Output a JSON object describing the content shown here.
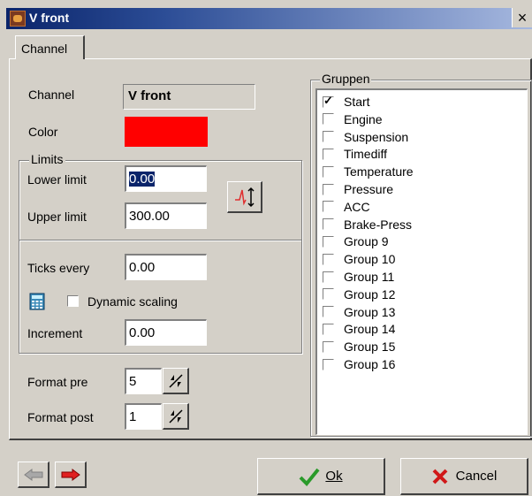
{
  "window": {
    "title": "V front"
  },
  "tabs": [
    "Channel"
  ],
  "channel": {
    "channel_label": "Channel",
    "channel_value": "V front",
    "color_label": "Color",
    "color_value": "#ff0000",
    "limits_title": "Limits",
    "lower_label": "Lower limit",
    "lower_value": "0.00",
    "upper_label": "Upper limit",
    "upper_value": "300.00",
    "ticks_label": "Ticks every",
    "ticks_value": "0.00",
    "dynamic_label": "Dynamic scaling",
    "dynamic_checked": false,
    "increment_label": "Increment",
    "increment_value": "0.00",
    "format_pre_label": "Format pre",
    "format_pre_value": "5",
    "format_post_label": "Format post",
    "format_post_value": "1"
  },
  "groups": {
    "title": "Gruppen",
    "items": [
      {
        "label": "Start",
        "checked": true
      },
      {
        "label": "Engine",
        "checked": false
      },
      {
        "label": "Suspension",
        "checked": false
      },
      {
        "label": "Timediff",
        "checked": false
      },
      {
        "label": "Temperature",
        "checked": false
      },
      {
        "label": "Pressure",
        "checked": false
      },
      {
        "label": "ACC",
        "checked": false
      },
      {
        "label": "Brake-Press",
        "checked": false
      },
      {
        "label": "Group 9",
        "checked": false
      },
      {
        "label": "Group 10",
        "checked": false
      },
      {
        "label": "Group 11",
        "checked": false
      },
      {
        "label": "Group 12",
        "checked": false
      },
      {
        "label": "Group 13",
        "checked": false
      },
      {
        "label": "Group 14",
        "checked": false
      },
      {
        "label": "Group 15",
        "checked": false
      },
      {
        "label": "Group 16",
        "checked": false
      }
    ]
  },
  "buttons": {
    "ok_label": "Ok",
    "cancel_label": "Cancel"
  },
  "icons": {
    "app": "app-icon",
    "close": "close-icon",
    "scale": "scale-icon",
    "calculator": "calculator-icon",
    "prev": "arrow-left-icon",
    "next": "arrow-right-icon"
  }
}
